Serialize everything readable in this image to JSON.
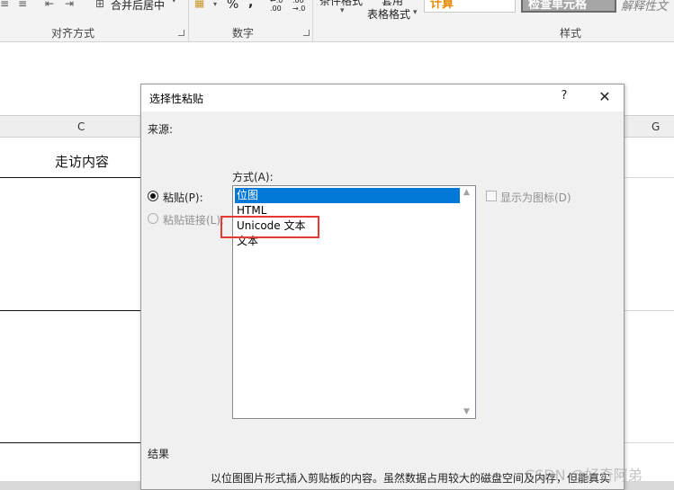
{
  "ribbon": {
    "merge_center_label": "合并后居中",
    "percent": "%",
    "comma": ",",
    "dec_inc": "←.0\n.00",
    "dec_dec": ".00\n→.0",
    "cond_format_label": "条件格式",
    "table_style_top": "套用",
    "table_style_label": "表格格式",
    "style_calc": "计算",
    "style_check": "检查单元格",
    "style_explain": "解释性文",
    "groups": {
      "alignment": "对齐方式",
      "number": "数字",
      "styles": "样式"
    }
  },
  "sheet": {
    "col_c": "C",
    "col_g": "G",
    "cell_c2": "走访内容"
  },
  "dialog": {
    "title": "选择性粘贴",
    "help": "?",
    "close": "✕",
    "source_label": "来源:",
    "method_label": "方式(A):",
    "paste_label": "粘贴(P):",
    "paste_link_label": "粘贴链接(L):",
    "display_as_icon": "显示为图标(D)",
    "list_items": [
      "位图",
      "HTML",
      "Unicode 文本",
      "文本"
    ],
    "selected_index": 0,
    "result_label": "结果",
    "result_text": "以位图图片形式插入剪贴板的内容。虽然数据占用较大的磁盘空间及内存，但能真实"
  },
  "watermark": "CSDN @好奇阿弟",
  "colors": {
    "selection": "#0078d7",
    "highlight_box": "#e53935",
    "calc_text": "#e68a00"
  }
}
